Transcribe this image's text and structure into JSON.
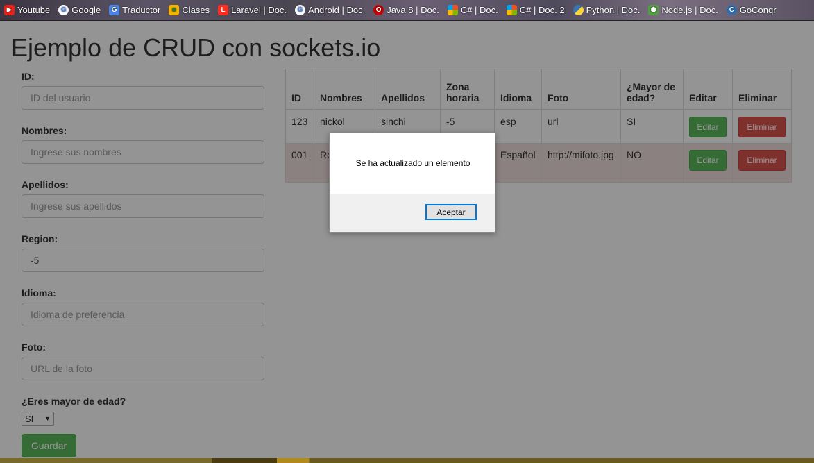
{
  "bookmarks": [
    {
      "label": "Youtube",
      "icon": "youtube-icon"
    },
    {
      "label": "Google",
      "icon": "google-icon"
    },
    {
      "label": "Traductor",
      "icon": "translate-icon"
    },
    {
      "label": "Clases",
      "icon": "classroom-icon"
    },
    {
      "label": "Laravel | Doc.",
      "icon": "laravel-icon"
    },
    {
      "label": "Android | Doc.",
      "icon": "google-icon"
    },
    {
      "label": "Java 8 | Doc.",
      "icon": "oracle-icon"
    },
    {
      "label": "C# | Doc.",
      "icon": "microsoft-icon"
    },
    {
      "label": "C# | Doc. 2",
      "icon": "microsoft-icon"
    },
    {
      "label": "Python | Doc.",
      "icon": "python-icon"
    },
    {
      "label": "Node.js | Doc.",
      "icon": "nodejs-icon"
    },
    {
      "label": "GoConqr",
      "icon": "goconqr-icon"
    }
  ],
  "page": {
    "title": "Ejemplo de CRUD con sockets.io"
  },
  "form": {
    "id_label": "ID:",
    "id_placeholder": "ID del usuario",
    "nombres_label": "Nombres:",
    "nombres_placeholder": "Ingrese sus nombres",
    "apellidos_label": "Apellidos:",
    "apellidos_placeholder": "Ingrese sus apellidos",
    "region_label": "Region:",
    "region_value": "-5",
    "idioma_label": "Idioma:",
    "idioma_placeholder": "Idioma de preferencia",
    "foto_label": "Foto:",
    "foto_placeholder": "URL de la foto",
    "mayor_label": "¿Eres mayor de edad?",
    "mayor_value": "SI",
    "save_label": "Guardar"
  },
  "table": {
    "headers": [
      "ID",
      "Nombres",
      "Apellidos",
      "Zona horaria",
      "Idioma",
      "Foto",
      "¿Mayor de edad?",
      "Editar",
      "Eliminar"
    ],
    "rows": [
      {
        "id": "123",
        "nombres": "nickol",
        "apellidos": "sinchi",
        "zona": "-5",
        "idioma": "esp",
        "foto": "url",
        "mayor": "SI",
        "edit": "Editar",
        "del": "Eliminar"
      },
      {
        "id": "001",
        "nombres": "Ro Ho",
        "apellidos": "",
        "zona": "",
        "idioma": "Español",
        "foto": "http://mifoto.jpg",
        "mayor": "NO",
        "edit": "Editar",
        "del": "Eliminar"
      }
    ]
  },
  "dialog": {
    "message": "Se ha actualizado un elemento",
    "ok_label": "Aceptar"
  },
  "colors": {
    "success": "#5cb85c",
    "danger": "#d9534f",
    "row_danger": "#f2dede",
    "dialog_focus": "#0078d7"
  }
}
